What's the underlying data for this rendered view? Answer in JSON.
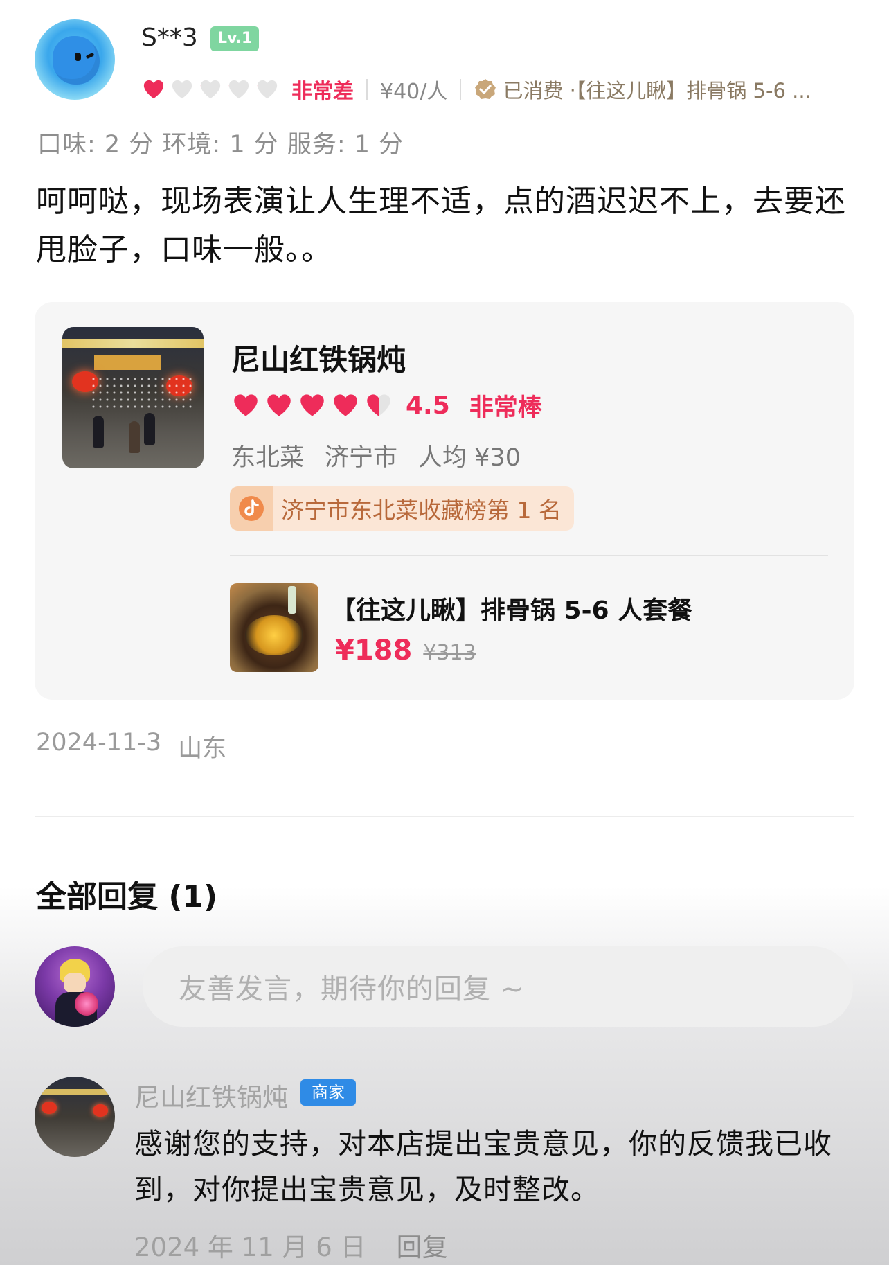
{
  "review": {
    "username": "S**3",
    "level": "Lv.1",
    "rating_hearts": 1,
    "rating_max": 5,
    "verdict": "非常差",
    "price_per_person": "¥40/人",
    "consumed_label": "已消费 ·【往这儿瞅】排骨锅 5-6 ...",
    "subscores": "口味: 2 分  环境: 1 分  服务: 1 分",
    "text": "呵呵哒，现场表演让人生理不适，点的酒迟迟不上，去要还甩脸子，口味一般。。",
    "date": "2024-11-3",
    "location": "山东"
  },
  "shop": {
    "name": "尼山红铁锅炖",
    "rating_hearts": 4.5,
    "score": "4.5",
    "verdict": "非常棒",
    "cuisine": "东北菜",
    "city": "济宁市",
    "avg_price": "人均 ¥30",
    "rank": "济宁市东北菜收藏榜第 1 名"
  },
  "deal": {
    "name": "【往这儿瞅】排骨锅 5-6 人套餐",
    "price": "¥188",
    "original_price": "¥313"
  },
  "replies": {
    "title": "全部回复 (1)",
    "input_placeholder": "友善发言，期待你的回复 ~",
    "items": [
      {
        "author": "尼山红铁锅炖",
        "badge": "商家",
        "text": "感谢您的支持，对本店提出宝贵意见，你的反馈我已收到，对你提出宝贵意见，及时整改。",
        "date": "2024 年 11 月 6 日",
        "reply_label": "回复"
      }
    ]
  },
  "colors": {
    "accent_red": "#ee2c5a",
    "heart_empty": "#e4e4e4",
    "merchant_blue": "#2f8be6",
    "level_green": "#7fd6a0",
    "rank_orange": "#b8693b"
  },
  "icons": {
    "heart": "heart-icon",
    "verified": "verified-check-icon",
    "rank": "douyin-rank-icon"
  }
}
